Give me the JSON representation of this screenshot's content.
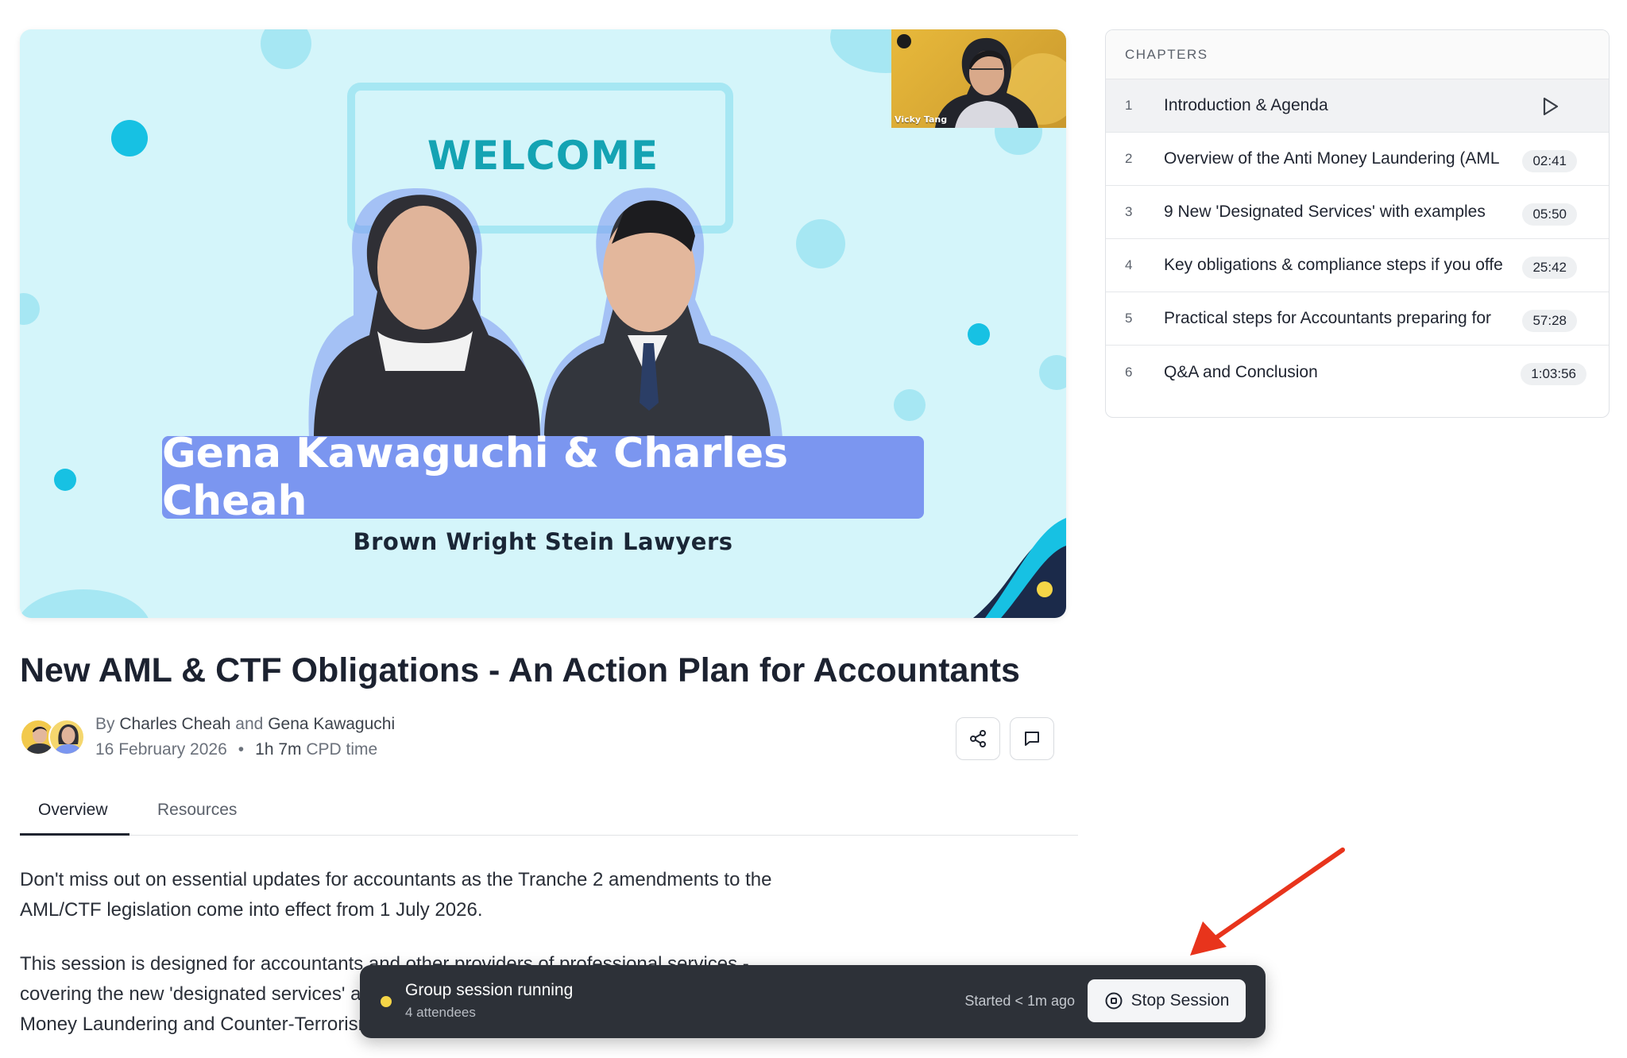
{
  "video": {
    "welcome_text": "WELCOME",
    "presenters_banner": "Gena Kawaguchi & Charles Cheah",
    "firm_name": "Brown Wright Stein Lawyers",
    "camera_name": "Vicky Tang"
  },
  "chapters": {
    "heading": "CHAPTERS",
    "items": [
      {
        "num": "1",
        "title": "Introduction & Agenda",
        "time": ""
      },
      {
        "num": "2",
        "title": "Overview of the Anti Money Laundering (AML",
        "time": "02:41"
      },
      {
        "num": "3",
        "title": "9 New 'Designated Services' with examples",
        "time": "05:50"
      },
      {
        "num": "4",
        "title": "Key obligations & compliance steps if you offe",
        "time": "25:42"
      },
      {
        "num": "5",
        "title": "Practical steps for Accountants preparing for",
        "time": "57:28"
      },
      {
        "num": "6",
        "title": "Q&A and Conclusion",
        "time": "1:03:56"
      }
    ]
  },
  "course": {
    "title": "New AML & CTF Obligations - An Action Plan for Accountants",
    "by": "By",
    "author1": "Charles Cheah",
    "and": "and",
    "author2": "Gena Kawaguchi",
    "date": "16 February 2026",
    "dot": "•",
    "duration": "1h 7m",
    "duration_suffix": "CPD time"
  },
  "tabs": {
    "overview": "Overview",
    "resources": "Resources"
  },
  "description": {
    "p1": "Don't miss out on essential updates for accountants as the Tranche 2 amendments to the AML/CTF legislation come into effect from 1 July 2026.",
    "p2": "This session is designed for accountants and other providers of professional services - covering the new 'designated services' and what you need to do to comply under the Anti-Money Laundering and Counter-Terrorism Financing reforms."
  },
  "session": {
    "title": "Group session running",
    "attendees": "4 attendees",
    "started": "Started < 1m ago",
    "stop_label": "Stop Session"
  },
  "colors": {
    "slide_bg": "#d4f5fa",
    "banner": "#7b96f0",
    "welcome": "#14a3b3",
    "session_bar": "#2d3138",
    "status_dot": "#f5d547",
    "arrow": "#e8341c"
  }
}
